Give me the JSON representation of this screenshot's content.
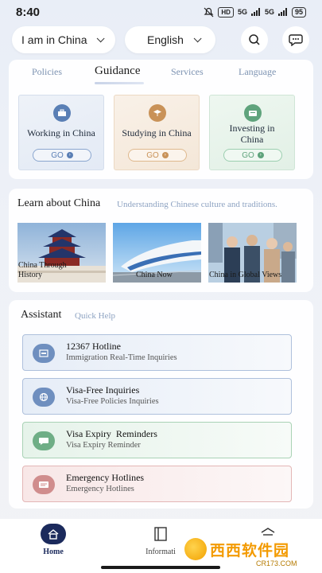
{
  "status_bar": {
    "time": "8:40",
    "network": "HD",
    "signal1": "5G",
    "signal2": "5G",
    "battery": "95"
  },
  "top": {
    "region_label": "I am in China",
    "language_label": "English"
  },
  "tabs": [
    {
      "label": "Policies"
    },
    {
      "label": "Guidance"
    },
    {
      "label": "Services"
    },
    {
      "label": "Language"
    }
  ],
  "guidance": [
    {
      "title": "Working in China",
      "button": "GO",
      "accent": "#5a7fb5",
      "icon": "briefcase-icon"
    },
    {
      "title": "Studying in China",
      "button": "GO",
      "accent": "#c99258",
      "icon": "study-icon"
    },
    {
      "title": "Investing in China",
      "button": "GO",
      "accent": "#5fa37c",
      "icon": "investment-icon"
    }
  ],
  "learn": {
    "title": "Learn about China",
    "subtitle": "Understanding Chinese culture and traditions.",
    "items": [
      {
        "caption": "China Through History",
        "scene": "temple"
      },
      {
        "caption": "China Now",
        "scene": "train"
      },
      {
        "caption": "China in Global Views",
        "scene": "people"
      }
    ]
  },
  "assistant": {
    "title": "Assistant",
    "subtitle": "Quick Help",
    "items": [
      {
        "title": "12367 Hotline",
        "subtitle": "Immigration Real-Time Inquiries",
        "accent": "#6f8fbf",
        "icon": "hotline-icon"
      },
      {
        "title": "Visa-Free Inquiries",
        "subtitle": "Visa-Free Policies Inquiries",
        "accent": "#6f8fbf",
        "icon": "globe-icon"
      },
      {
        "title": "Visa Expiry  Reminders",
        "subtitle": "Visa Expiry Reminder",
        "accent": "#6fae86",
        "icon": "reminder-icon"
      },
      {
        "title": "Emergency Hotlines",
        "subtitle": "Emergency Hotlines",
        "accent": "#d08d8d",
        "icon": "emergency-icon"
      }
    ]
  },
  "nav": {
    "home": "Home",
    "info": "Informati",
    "third": ""
  },
  "watermark": {
    "text": "西西软件园",
    "url": "CR173.COM"
  },
  "colors": {
    "primary": "#1b2a5c",
    "tab_inactive": "#7d93b2"
  }
}
